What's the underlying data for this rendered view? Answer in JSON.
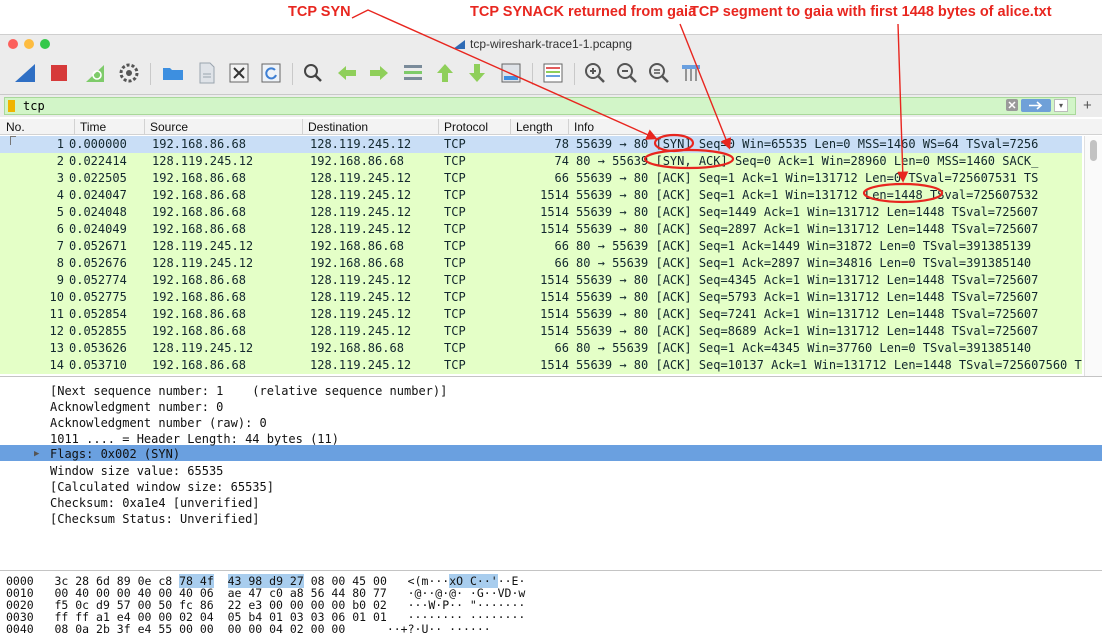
{
  "annotations": {
    "syn": "TCP SYN",
    "synack": "TCP SYNACK returned from gaia",
    "segment": "TCP segment to gaia with first 1448 bytes of alice.txt"
  },
  "window": {
    "title": "tcp-wireshark-trace1-1.pcapng"
  },
  "filter": {
    "value": "tcp"
  },
  "columns": [
    "No.",
    "Time",
    "Source",
    "Destination",
    "Protocol",
    "Length",
    "Info"
  ],
  "packets": [
    {
      "no": "1",
      "time": "0.000000",
      "src": "192.168.86.68",
      "dst": "128.119.245.12",
      "proto": "TCP",
      "len": "78",
      "info": "55639 → 80 [SYN] Seq=0 Win=65535 Len=0 MSS=1460 WS=64 TSval=7256"
    },
    {
      "no": "2",
      "time": "0.022414",
      "src": "128.119.245.12",
      "dst": "192.168.86.68",
      "proto": "TCP",
      "len": "74",
      "info": "80 → 55639 [SYN, ACK] Seq=0 Ack=1 Win=28960 Len=0 MSS=1460 SACK_"
    },
    {
      "no": "3",
      "time": "0.022505",
      "src": "192.168.86.68",
      "dst": "128.119.245.12",
      "proto": "TCP",
      "len": "66",
      "info": "55639 → 80 [ACK] Seq=1 Ack=1 Win=131712 Len=0 TSval=725607531 TS"
    },
    {
      "no": "4",
      "time": "0.024047",
      "src": "192.168.86.68",
      "dst": "128.119.245.12",
      "proto": "TCP",
      "len": "1514",
      "info": "55639 → 80 [ACK] Seq=1 Ack=1 Win=131712 Len=1448 TSval=725607532"
    },
    {
      "no": "5",
      "time": "0.024048",
      "src": "192.168.86.68",
      "dst": "128.119.245.12",
      "proto": "TCP",
      "len": "1514",
      "info": "55639 → 80 [ACK] Seq=1449 Ack=1 Win=131712 Len=1448 TSval=725607"
    },
    {
      "no": "6",
      "time": "0.024049",
      "src": "192.168.86.68",
      "dst": "128.119.245.12",
      "proto": "TCP",
      "len": "1514",
      "info": "55639 → 80 [ACK] Seq=2897 Ack=1 Win=131712 Len=1448 TSval=725607"
    },
    {
      "no": "7",
      "time": "0.052671",
      "src": "128.119.245.12",
      "dst": "192.168.86.68",
      "proto": "TCP",
      "len": "66",
      "info": "80 → 55639 [ACK] Seq=1 Ack=1449 Win=31872 Len=0 TSval=391385139"
    },
    {
      "no": "8",
      "time": "0.052676",
      "src": "128.119.245.12",
      "dst": "192.168.86.68",
      "proto": "TCP",
      "len": "66",
      "info": "80 → 55639 [ACK] Seq=1 Ack=2897 Win=34816 Len=0 TSval=391385140"
    },
    {
      "no": "9",
      "time": "0.052774",
      "src": "192.168.86.68",
      "dst": "128.119.245.12",
      "proto": "TCP",
      "len": "1514",
      "info": "55639 → 80 [ACK] Seq=4345 Ack=1 Win=131712 Len=1448 TSval=725607"
    },
    {
      "no": "10",
      "time": "0.052775",
      "src": "192.168.86.68",
      "dst": "128.119.245.12",
      "proto": "TCP",
      "len": "1514",
      "info": "55639 → 80 [ACK] Seq=5793 Ack=1 Win=131712 Len=1448 TSval=725607"
    },
    {
      "no": "11",
      "time": "0.052854",
      "src": "192.168.86.68",
      "dst": "128.119.245.12",
      "proto": "TCP",
      "len": "1514",
      "info": "55639 → 80 [ACK] Seq=7241 Ack=1 Win=131712 Len=1448 TSval=725607"
    },
    {
      "no": "12",
      "time": "0.052855",
      "src": "192.168.86.68",
      "dst": "128.119.245.12",
      "proto": "TCP",
      "len": "1514",
      "info": "55639 → 80 [ACK] Seq=8689 Ack=1 Win=131712 Len=1448 TSval=725607"
    },
    {
      "no": "13",
      "time": "0.053626",
      "src": "128.119.245.12",
      "dst": "192.168.86.68",
      "proto": "TCP",
      "len": "66",
      "info": "80 → 55639 [ACK] Seq=1 Ack=4345 Win=37760 Len=0 TSval=391385140"
    },
    {
      "no": "14",
      "time": "0.053710",
      "src": "192.168.86.68",
      "dst": "128.119.245.12",
      "proto": "TCP",
      "len": "1514",
      "info": "55639 → 80 [ACK] Seq=10137 Ack=1 Win=131712 Len=1448 TSval=725607560 T"
    }
  ],
  "details": [
    "[Next sequence number: 1    (relative sequence number)]",
    "Acknowledgment number: 0",
    "Acknowledgment number (raw): 0",
    "1011 .... = Header Length: 44 bytes (11)",
    "Flags: 0x002 (SYN)",
    "Window size value: 65535",
    "[Calculated window size: 65535]",
    "Checksum: 0xa1e4 [unverified]",
    "[Checksum Status: Unverified]"
  ],
  "bytes": [
    {
      "offset": "0000",
      "hex_a": "3c 28 6d 89 0e c8",
      "hex_hl1": "78 4f",
      "hex_hl2": "43 98 d9 27",
      "hex_b": "08 00 45 00",
      "ascii_a": "<(m···",
      "ascii_hl": "xO C··'",
      "ascii_b": "··E·"
    },
    {
      "offset": "0010",
      "hex": "00 40 00 00 40 00 40 06  ae 47 c0 a8 56 44 80 77",
      "ascii": "·@··@·@· ·G··VD·w"
    },
    {
      "offset": "0020",
      "hex": "f5 0c d9 57 00 50 fc 86  22 e3 00 00 00 00 b0 02",
      "ascii": "···W·P·· \"·······"
    },
    {
      "offset": "0030",
      "hex": "ff ff a1 e4 00 00 02 04  05 b4 01 03 03 06 01 01",
      "ascii": "········ ········"
    },
    {
      "offset": "0040",
      "hex": "08 0a 2b 3f e4 55 00 00  00 00 04 02 00 00",
      "ascii": "··+?·U·· ······"
    }
  ],
  "colors": {
    "annotation": "#e8261f",
    "row_selected": "#c9def6",
    "row_green": "#e4ffc7",
    "detail_selected": "#6aa0e0"
  }
}
